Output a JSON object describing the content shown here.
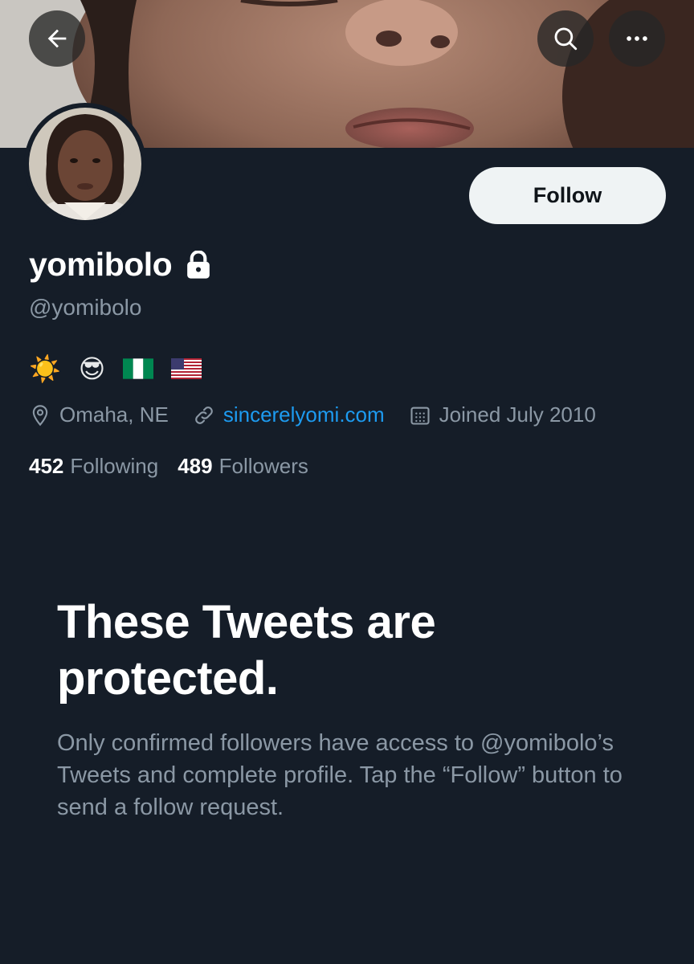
{
  "profile": {
    "display_name": "yomibolo",
    "handle": "@yomibolo",
    "bio_emojis": [
      "☀️",
      "😎",
      "🇳🇬",
      "🇺🇸"
    ],
    "location": "Omaha, NE",
    "website": "sincerelyomi.com",
    "joined": "Joined July 2010",
    "following_count": "452",
    "following_label": "Following",
    "followers_count": "489",
    "followers_label": "Followers"
  },
  "actions": {
    "follow_label": "Follow"
  },
  "protected": {
    "title": "These Tweets are protected.",
    "message": "Only confirmed followers have access to @yomibolo’s Tweets and complete profile. Tap the “Follow” button to send a follow request."
  },
  "icons": {
    "back": "back-arrow-icon",
    "search": "search-icon",
    "more": "more-icon",
    "lock": "lock-icon",
    "location": "location-pin-icon",
    "link": "link-icon",
    "calendar": "calendar-icon"
  },
  "colors": {
    "background": "#151d28",
    "primary_text": "#ffffff",
    "secondary_text": "#8b98a5",
    "link": "#1d9bf0",
    "follow_button_bg": "#eff3f4"
  }
}
